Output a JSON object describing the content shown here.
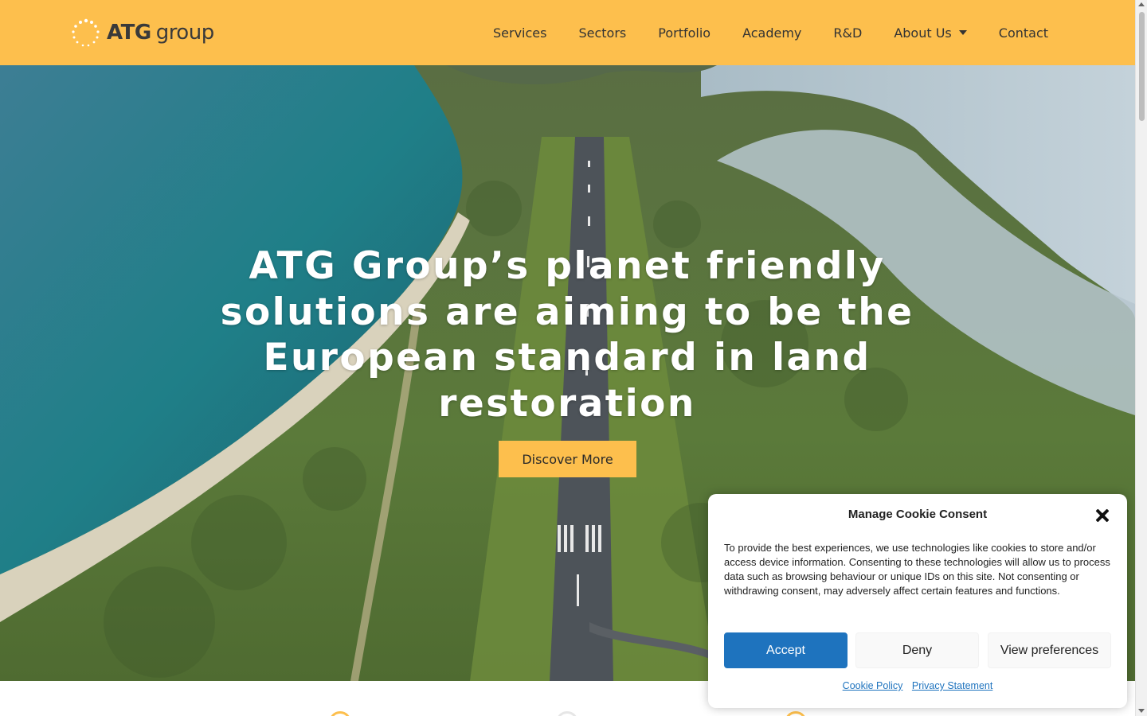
{
  "brand": {
    "logo_icon": "atg-dotted-circle-logo",
    "logo_bold": "ATG",
    "logo_light": "group"
  },
  "nav": {
    "items": [
      {
        "label": "Services"
      },
      {
        "label": "Sectors"
      },
      {
        "label": "Portfolio"
      },
      {
        "label": "Academy"
      },
      {
        "label": "R&D"
      },
      {
        "label": "About Us",
        "icon": "caret-down-icon"
      },
      {
        "label": "Contact"
      }
    ]
  },
  "hero": {
    "title": "ATG Group’s planet friendly solutions are aiming to be the European standard in land restoration",
    "cta_label": "Discover More",
    "image": "aerial-runway-coastline-photo"
  },
  "cookie": {
    "title": "Manage Cookie Consent",
    "body": "To provide the best experiences, we use technologies like cookies to store and/or access device information. Consenting to these technologies will allow us to process data such as browsing behaviour or unique IDs on this site. Not consenting or withdrawing consent, may adversely affect certain features and functions.",
    "accept_label": "Accept",
    "deny_label": "Deny",
    "preferences_label": "View preferences",
    "cookie_policy_label": "Cookie Policy",
    "privacy_label": "Privacy Statement",
    "close_icon": "close-icon"
  },
  "colors": {
    "brand_yellow": "#fdbf4d",
    "accept_blue": "#1e73be"
  }
}
